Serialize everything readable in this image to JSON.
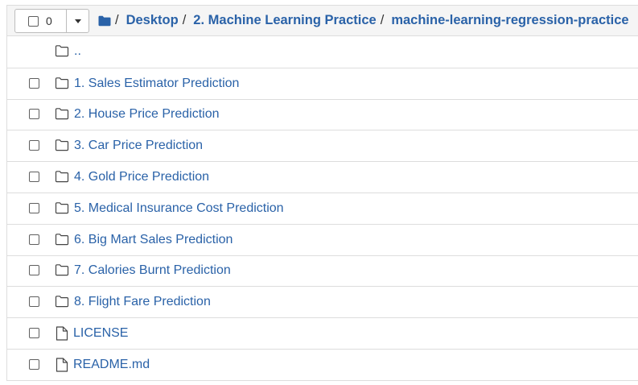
{
  "toolbar": {
    "selected_count": "0"
  },
  "breadcrumb": {
    "home_icon": "folder-icon",
    "separator": "/",
    "items": [
      "Desktop",
      "2. Machine Learning Practice",
      "machine-learning-regression-practice"
    ]
  },
  "listing": {
    "parent_label": "..",
    "items": [
      {
        "name": "1. Sales Estimator Prediction",
        "type": "folder",
        "icon": "folder-icon"
      },
      {
        "name": "2. House Price Prediction",
        "type": "folder",
        "icon": "folder-icon"
      },
      {
        "name": "3. Car Price Prediction",
        "type": "folder",
        "icon": "folder-icon"
      },
      {
        "name": "4. Gold Price Prediction",
        "type": "folder",
        "icon": "folder-icon"
      },
      {
        "name": "5. Medical Insurance Cost Prediction",
        "type": "folder",
        "icon": "folder-icon"
      },
      {
        "name": "6. Big Mart Sales Prediction",
        "type": "folder",
        "icon": "folder-icon"
      },
      {
        "name": "7. Calories Burnt Prediction",
        "type": "folder",
        "icon": "folder-icon"
      },
      {
        "name": "8. Flight Fare Prediction",
        "type": "folder",
        "icon": "folder-icon"
      },
      {
        "name": "LICENSE",
        "type": "file",
        "icon": "file-icon"
      },
      {
        "name": "README.md",
        "type": "file",
        "icon": "file-icon"
      }
    ]
  },
  "colors": {
    "link": "#2a62a8",
    "header_bg": "#f5f5f5",
    "border": "#dddddd"
  }
}
